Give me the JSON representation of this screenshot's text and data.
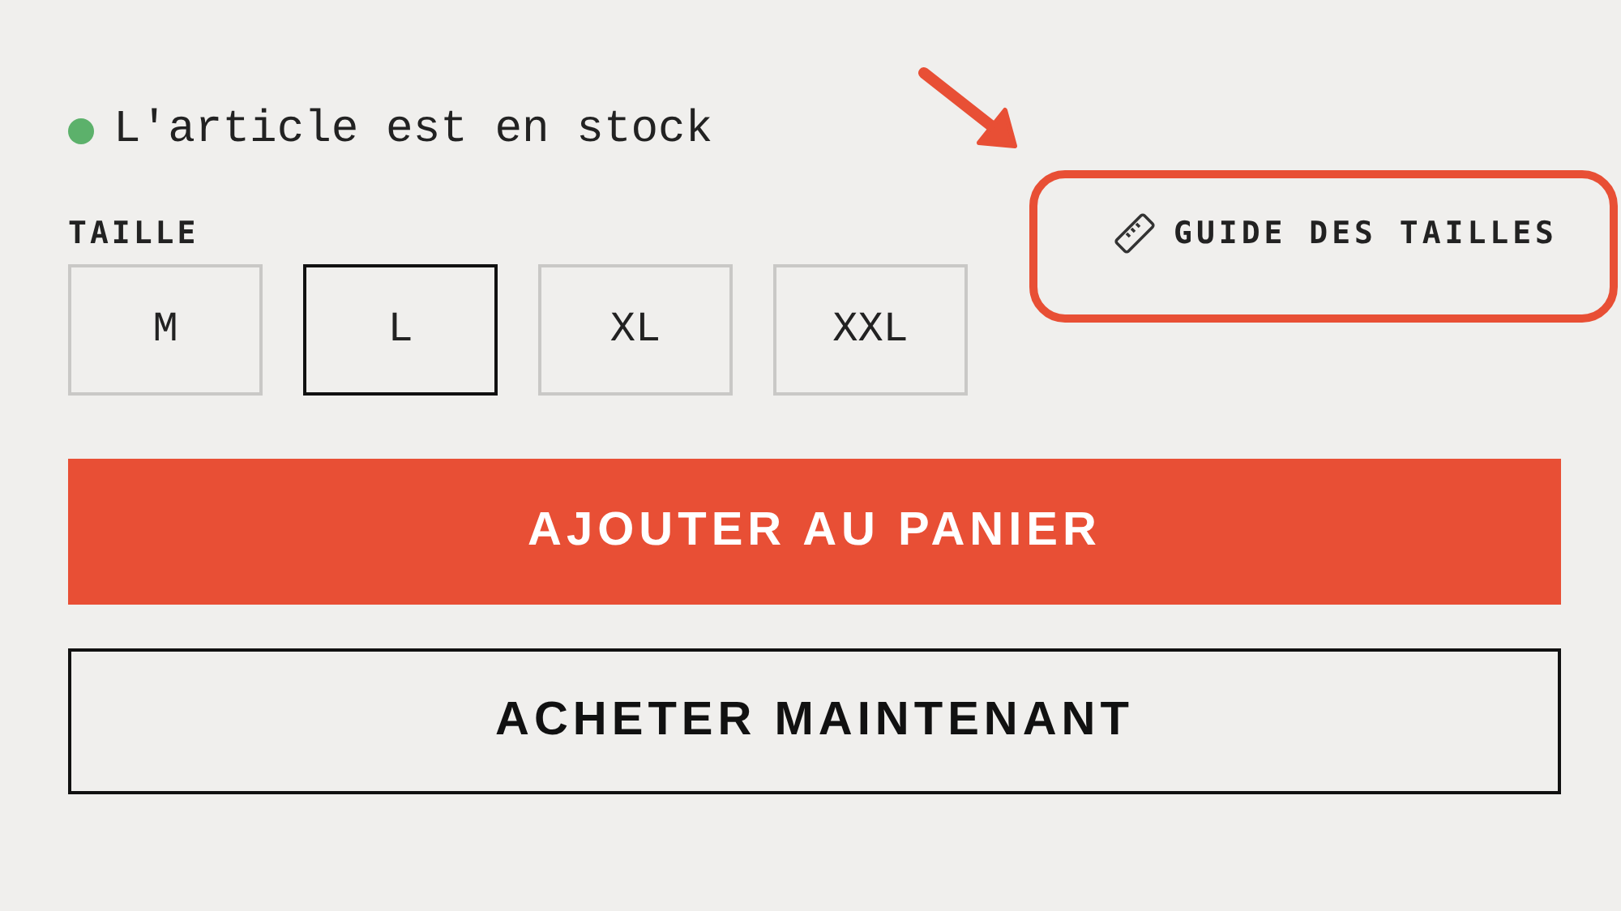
{
  "stock": {
    "text": "L'article est en stock",
    "available": true
  },
  "size_label": "TAILLE",
  "size_guide": {
    "label": "GUIDE DES TAILLES",
    "highlighted": true
  },
  "sizes": [
    {
      "label": "M",
      "selected": false
    },
    {
      "label": "L",
      "selected": true
    },
    {
      "label": "XL",
      "selected": false
    },
    {
      "label": "XXL",
      "selected": false
    }
  ],
  "buttons": [
    {
      "label": "AJOUTER AU PANIER",
      "kind": "primary"
    },
    {
      "label": "ACHETER MAINTENANT",
      "kind": "secondary"
    }
  ]
}
